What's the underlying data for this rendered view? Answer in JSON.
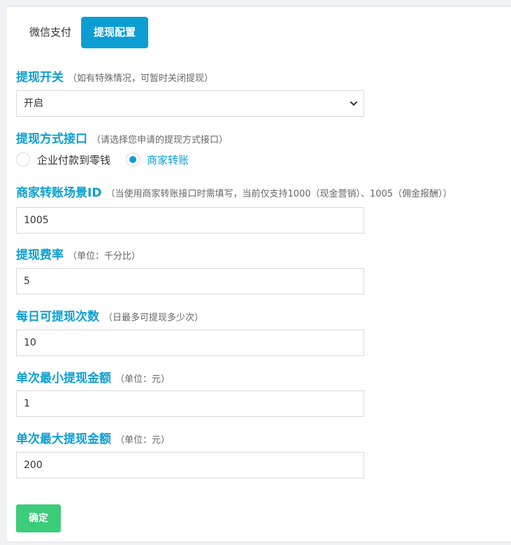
{
  "tabs": [
    {
      "label": "微信支付",
      "active": false
    },
    {
      "label": "提现配置",
      "active": true
    }
  ],
  "fields": {
    "switch": {
      "title": "提现开关",
      "hint": "（如有特殊情况，可暂时关闭提现）",
      "value": "开启"
    },
    "method": {
      "title": "提现方式接口",
      "hint": "（请选择您申请的提现方式接口）",
      "options": [
        {
          "label": "企业付款到零钱",
          "checked": false
        },
        {
          "label": "商家转账",
          "checked": true
        }
      ]
    },
    "scene_id": {
      "title": "商家转账场景ID",
      "hint": "（当使用商家转账接口时需填写，当前仅支持1000（现金营销）、1005（佣金报酬））",
      "value": "1005"
    },
    "fee_rate": {
      "title": "提现费率",
      "hint": "（单位：千分比）",
      "value": "5"
    },
    "daily_times": {
      "title": "每日可提现次数",
      "hint": "（日最多可提现多少次）",
      "value": "10"
    },
    "min_amount": {
      "title": "单次最小提现金额",
      "hint": "（单位：元）",
      "value": "1"
    },
    "max_amount": {
      "title": "单次最大提现金额",
      "hint": "（单位：元）",
      "value": "200"
    }
  },
  "submit_label": "确定",
  "colors": {
    "accent": "#0c9ed2",
    "submit": "#3ccc7a"
  }
}
